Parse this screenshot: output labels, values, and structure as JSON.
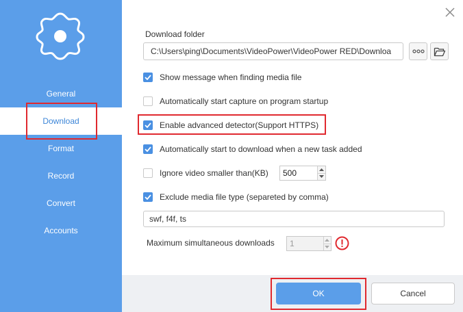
{
  "sidebar": {
    "items": [
      {
        "label": "General",
        "active": false
      },
      {
        "label": "Download",
        "active": true
      },
      {
        "label": "Format",
        "active": false
      },
      {
        "label": "Record",
        "active": false
      },
      {
        "label": "Convert",
        "active": false
      },
      {
        "label": "Accounts",
        "active": false
      }
    ]
  },
  "download": {
    "folder_label": "Download folder",
    "folder_path": "C:\\Users\\ping\\Documents\\VideoPower\\VideoPower RED\\Downloa",
    "options": [
      {
        "label": "Show message when finding media file",
        "checked": true
      },
      {
        "label": "Automatically start capture on program startup",
        "checked": false
      },
      {
        "label": "Enable advanced detector(Support HTTPS)",
        "checked": true
      },
      {
        "label": "Automatically start to download when a new task added",
        "checked": true
      },
      {
        "label": "Ignore video smaller than(KB)",
        "checked": false
      },
      {
        "label": "Exclude media file type (separeted by comma)",
        "checked": true
      }
    ],
    "ignore_size_value": "500",
    "exclude_types_value": "swf, f4f, ts",
    "max_downloads_label": "Maximum simultaneous downloads",
    "max_downloads_value": "1"
  },
  "footer": {
    "ok_label": "OK",
    "cancel_label": "Cancel"
  },
  "colors": {
    "sidebar": "#5b9ee9",
    "accent": "#4a90e2",
    "highlight": "#e0282e",
    "warning": "#e0282e"
  }
}
